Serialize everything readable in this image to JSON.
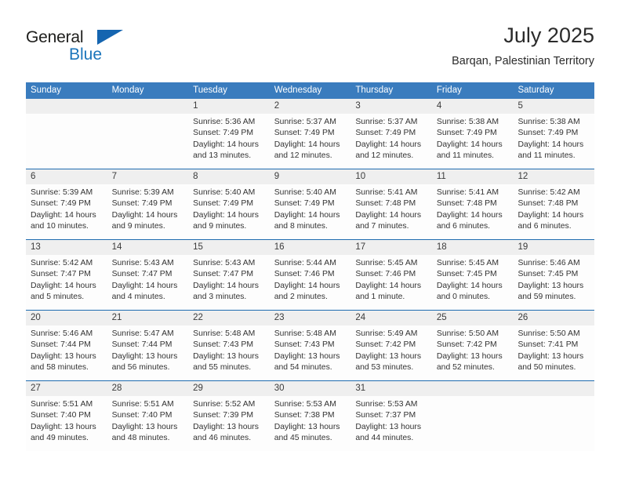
{
  "brand": {
    "name_dark": "General",
    "name_blue": "Blue",
    "triangle_icon": "triangle-icon",
    "accent_color": "#1b75bb"
  },
  "header": {
    "month_title": "July 2025",
    "location": "Barqan, Palestinian Territory"
  },
  "colors": {
    "header_blue": "#3a7cbe",
    "rule_blue": "#1f6cb0",
    "daynum_band": "#efefef"
  },
  "weekdays": [
    "Sunday",
    "Monday",
    "Tuesday",
    "Wednesday",
    "Thursday",
    "Friday",
    "Saturday"
  ],
  "weeks": [
    {
      "days": [
        {
          "num": "",
          "lines": [
            "",
            "",
            "",
            ""
          ],
          "empty": true
        },
        {
          "num": "",
          "lines": [
            "",
            "",
            "",
            ""
          ],
          "empty": true
        },
        {
          "num": "1",
          "lines": [
            "Sunrise: 5:36 AM",
            "Sunset: 7:49 PM",
            "Daylight: 14 hours",
            "and 13 minutes."
          ]
        },
        {
          "num": "2",
          "lines": [
            "Sunrise: 5:37 AM",
            "Sunset: 7:49 PM",
            "Daylight: 14 hours",
            "and 12 minutes."
          ]
        },
        {
          "num": "3",
          "lines": [
            "Sunrise: 5:37 AM",
            "Sunset: 7:49 PM",
            "Daylight: 14 hours",
            "and 12 minutes."
          ]
        },
        {
          "num": "4",
          "lines": [
            "Sunrise: 5:38 AM",
            "Sunset: 7:49 PM",
            "Daylight: 14 hours",
            "and 11 minutes."
          ]
        },
        {
          "num": "5",
          "lines": [
            "Sunrise: 5:38 AM",
            "Sunset: 7:49 PM",
            "Daylight: 14 hours",
            "and 11 minutes."
          ]
        }
      ]
    },
    {
      "days": [
        {
          "num": "6",
          "lines": [
            "Sunrise: 5:39 AM",
            "Sunset: 7:49 PM",
            "Daylight: 14 hours",
            "and 10 minutes."
          ]
        },
        {
          "num": "7",
          "lines": [
            "Sunrise: 5:39 AM",
            "Sunset: 7:49 PM",
            "Daylight: 14 hours",
            "and 9 minutes."
          ]
        },
        {
          "num": "8",
          "lines": [
            "Sunrise: 5:40 AM",
            "Sunset: 7:49 PM",
            "Daylight: 14 hours",
            "and 9 minutes."
          ]
        },
        {
          "num": "9",
          "lines": [
            "Sunrise: 5:40 AM",
            "Sunset: 7:49 PM",
            "Daylight: 14 hours",
            "and 8 minutes."
          ]
        },
        {
          "num": "10",
          "lines": [
            "Sunrise: 5:41 AM",
            "Sunset: 7:48 PM",
            "Daylight: 14 hours",
            "and 7 minutes."
          ]
        },
        {
          "num": "11",
          "lines": [
            "Sunrise: 5:41 AM",
            "Sunset: 7:48 PM",
            "Daylight: 14 hours",
            "and 6 minutes."
          ]
        },
        {
          "num": "12",
          "lines": [
            "Sunrise: 5:42 AM",
            "Sunset: 7:48 PM",
            "Daylight: 14 hours",
            "and 6 minutes."
          ]
        }
      ]
    },
    {
      "days": [
        {
          "num": "13",
          "lines": [
            "Sunrise: 5:42 AM",
            "Sunset: 7:47 PM",
            "Daylight: 14 hours",
            "and 5 minutes."
          ]
        },
        {
          "num": "14",
          "lines": [
            "Sunrise: 5:43 AM",
            "Sunset: 7:47 PM",
            "Daylight: 14 hours",
            "and 4 minutes."
          ]
        },
        {
          "num": "15",
          "lines": [
            "Sunrise: 5:43 AM",
            "Sunset: 7:47 PM",
            "Daylight: 14 hours",
            "and 3 minutes."
          ]
        },
        {
          "num": "16",
          "lines": [
            "Sunrise: 5:44 AM",
            "Sunset: 7:46 PM",
            "Daylight: 14 hours",
            "and 2 minutes."
          ]
        },
        {
          "num": "17",
          "lines": [
            "Sunrise: 5:45 AM",
            "Sunset: 7:46 PM",
            "Daylight: 14 hours",
            "and 1 minute."
          ]
        },
        {
          "num": "18",
          "lines": [
            "Sunrise: 5:45 AM",
            "Sunset: 7:45 PM",
            "Daylight: 14 hours",
            "and 0 minutes."
          ]
        },
        {
          "num": "19",
          "lines": [
            "Sunrise: 5:46 AM",
            "Sunset: 7:45 PM",
            "Daylight: 13 hours",
            "and 59 minutes."
          ]
        }
      ]
    },
    {
      "days": [
        {
          "num": "20",
          "lines": [
            "Sunrise: 5:46 AM",
            "Sunset: 7:44 PM",
            "Daylight: 13 hours",
            "and 58 minutes."
          ]
        },
        {
          "num": "21",
          "lines": [
            "Sunrise: 5:47 AM",
            "Sunset: 7:44 PM",
            "Daylight: 13 hours",
            "and 56 minutes."
          ]
        },
        {
          "num": "22",
          "lines": [
            "Sunrise: 5:48 AM",
            "Sunset: 7:43 PM",
            "Daylight: 13 hours",
            "and 55 minutes."
          ]
        },
        {
          "num": "23",
          "lines": [
            "Sunrise: 5:48 AM",
            "Sunset: 7:43 PM",
            "Daylight: 13 hours",
            "and 54 minutes."
          ]
        },
        {
          "num": "24",
          "lines": [
            "Sunrise: 5:49 AM",
            "Sunset: 7:42 PM",
            "Daylight: 13 hours",
            "and 53 minutes."
          ]
        },
        {
          "num": "25",
          "lines": [
            "Sunrise: 5:50 AM",
            "Sunset: 7:42 PM",
            "Daylight: 13 hours",
            "and 52 minutes."
          ]
        },
        {
          "num": "26",
          "lines": [
            "Sunrise: 5:50 AM",
            "Sunset: 7:41 PM",
            "Daylight: 13 hours",
            "and 50 minutes."
          ]
        }
      ]
    },
    {
      "days": [
        {
          "num": "27",
          "lines": [
            "Sunrise: 5:51 AM",
            "Sunset: 7:40 PM",
            "Daylight: 13 hours",
            "and 49 minutes."
          ]
        },
        {
          "num": "28",
          "lines": [
            "Sunrise: 5:51 AM",
            "Sunset: 7:40 PM",
            "Daylight: 13 hours",
            "and 48 minutes."
          ]
        },
        {
          "num": "29",
          "lines": [
            "Sunrise: 5:52 AM",
            "Sunset: 7:39 PM",
            "Daylight: 13 hours",
            "and 46 minutes."
          ]
        },
        {
          "num": "30",
          "lines": [
            "Sunrise: 5:53 AM",
            "Sunset: 7:38 PM",
            "Daylight: 13 hours",
            "and 45 minutes."
          ]
        },
        {
          "num": "31",
          "lines": [
            "Sunrise: 5:53 AM",
            "Sunset: 7:37 PM",
            "Daylight: 13 hours",
            "and 44 minutes."
          ]
        },
        {
          "num": "",
          "lines": [
            "",
            "",
            "",
            ""
          ],
          "empty": true
        },
        {
          "num": "",
          "lines": [
            "",
            "",
            "",
            ""
          ],
          "empty": true
        }
      ]
    }
  ]
}
